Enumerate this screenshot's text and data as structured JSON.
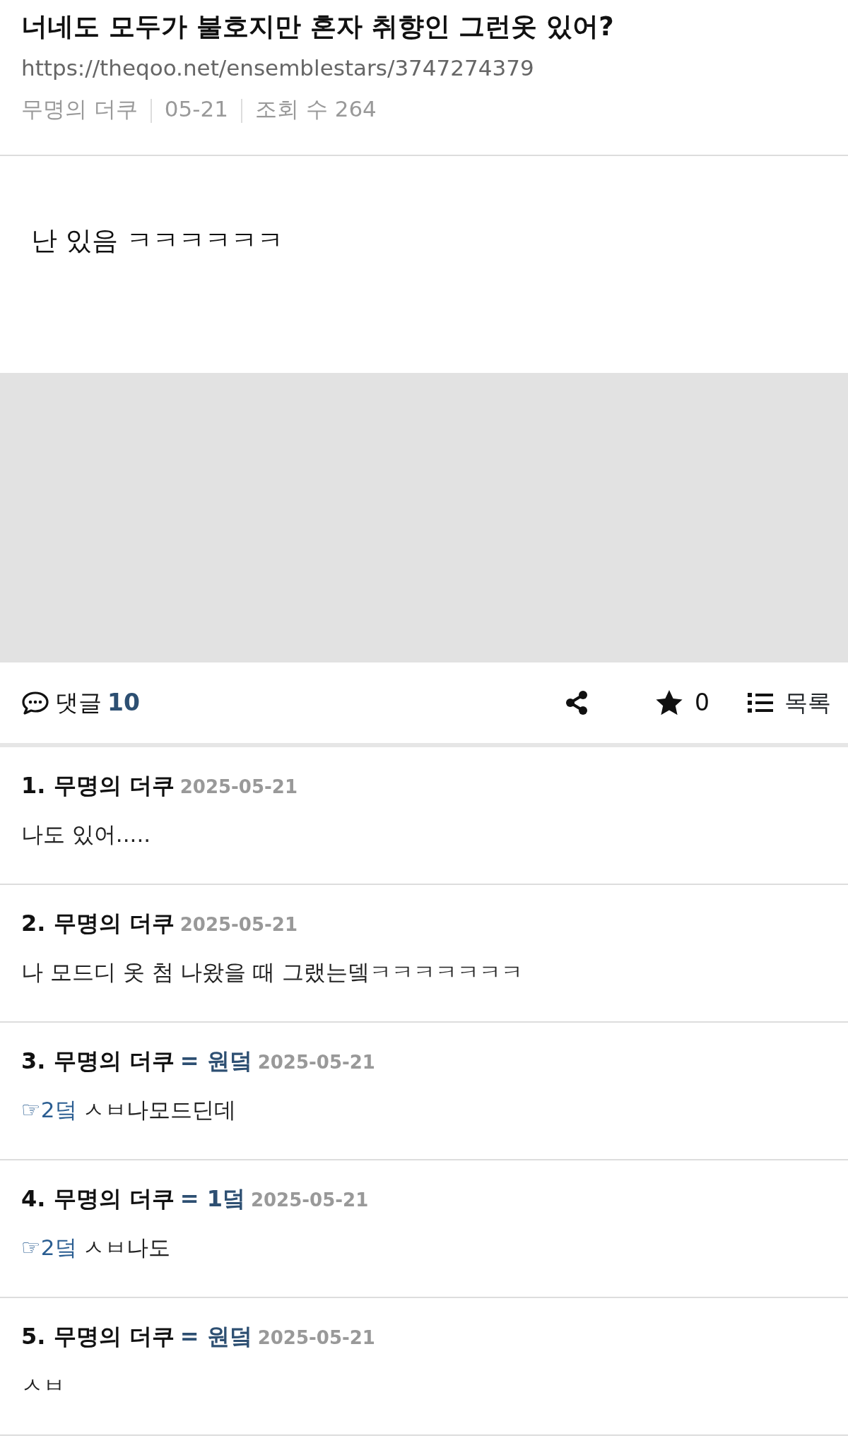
{
  "post": {
    "title": "너네도 모두가 불호지만 혼자 취향인 그런옷 있어?",
    "url": "https://theqoo.net/ensemblestars/3747274379",
    "author": "무명의 더쿠",
    "date": "05-21",
    "views": "조회 수 264",
    "body": "난 있음 ㅋㅋㅋㅋㅋㅋ"
  },
  "actions": {
    "comments_label": "댓글",
    "comments_count": "10",
    "stars": "0",
    "list_label": "목록"
  },
  "comments": [
    {
      "header": "1. 무명의 더쿠",
      "date": "2025-05-21",
      "text": "나도 있어....."
    },
    {
      "header": "2. 무명의 더쿠",
      "date": "2025-05-21",
      "text": "나 모드디 옷 첨 나왔을 때 그랬는뎈ㅋㅋㅋㅋㅋㅋㅋ"
    },
    {
      "header": "3. 무명의 더쿠",
      "tag": "= 원덬",
      "date": "2025-05-21",
      "reply_to": "☞2덬",
      "text": "ㅅㅂ나모드딘데"
    },
    {
      "header": "4. 무명의 더쿠",
      "tag": "= 1덬",
      "date": "2025-05-21",
      "reply_to": "☞2덬",
      "text": "ㅅㅂ나도"
    },
    {
      "header": "5. 무명의 더쿠",
      "tag": "= 원덬",
      "date": "2025-05-21",
      "text": "ㅅㅂ"
    }
  ]
}
